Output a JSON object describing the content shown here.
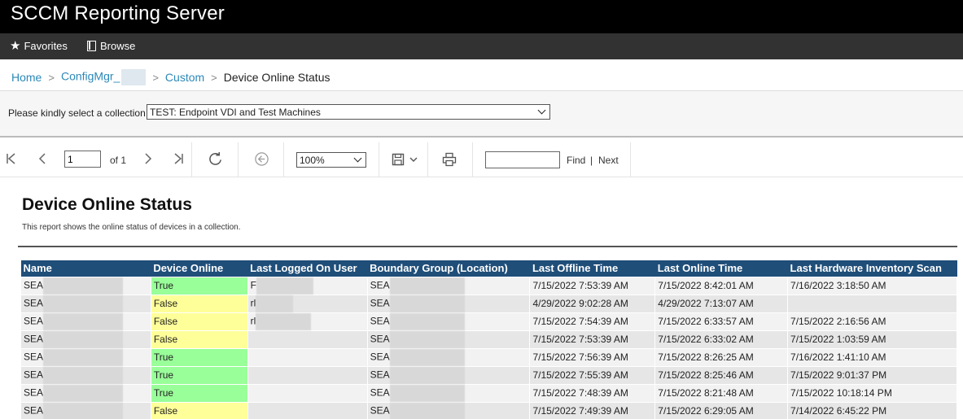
{
  "app": {
    "title": "SCCM Reporting Server"
  },
  "nav": {
    "favorites_label": "Favorites",
    "browse_label": "Browse"
  },
  "breadcrumb": {
    "home": "Home",
    "configmgr": "ConfigMgr_",
    "custom": "Custom",
    "current": "Device Online Status"
  },
  "parameters": {
    "collection_label": "Please kindly select a collection",
    "collection_value": "TEST: Endpoint VDI and Test Machines"
  },
  "toolbar": {
    "page_value": "1",
    "of_label": "of 1",
    "zoom_value": "100%",
    "find_label": "Find",
    "separator": "|",
    "next_label": "Next"
  },
  "report": {
    "title": "Device Online Status",
    "description": "This report shows the online status of devices in a collection."
  },
  "table": {
    "headers": [
      "Name",
      "Device Online",
      "Last Logged On User",
      "Boundary Group (Location)",
      "Last Offline Time",
      "Last Online Time",
      "Last Hardware Inventory Scan"
    ],
    "rows": [
      {
        "name": "SEA",
        "online": "True",
        "user": "F",
        "boundary": "SEA",
        "offline": "7/15/2022 7:53:39 AM",
        "online_time": "7/15/2022 8:42:01 AM",
        "hw_scan": "7/16/2022 3:18:50 AM"
      },
      {
        "name": "SEA",
        "online": "False",
        "user": "rl",
        "boundary": "SEA",
        "offline": "4/29/2022 9:02:28 AM",
        "online_time": "4/29/2022 7:13:07 AM",
        "hw_scan": ""
      },
      {
        "name": "SEA",
        "online": "False",
        "user": "rl",
        "boundary": "SEA",
        "offline": "7/15/2022 7:54:39 AM",
        "online_time": "7/15/2022 6:33:57 AM",
        "hw_scan": "7/15/2022 2:16:56 AM"
      },
      {
        "name": "SEA",
        "online": "False",
        "user": "",
        "boundary": "SEA",
        "offline": "7/15/2022 7:53:39 AM",
        "online_time": "7/15/2022 6:33:02 AM",
        "hw_scan": "7/15/2022 1:03:59 AM"
      },
      {
        "name": "SEA",
        "online": "True",
        "user": "",
        "boundary": "SEA",
        "offline": "7/15/2022 7:56:39 AM",
        "online_time": "7/15/2022 8:26:25 AM",
        "hw_scan": "7/16/2022 1:41:10 AM"
      },
      {
        "name": "SEA",
        "online": "True",
        "user": "",
        "boundary": "SEA",
        "offline": "7/15/2022 7:55:39 AM",
        "online_time": "7/15/2022 8:25:46 AM",
        "hw_scan": "7/15/2022 9:01:37 PM"
      },
      {
        "name": "SEA",
        "online": "True",
        "user": "",
        "boundary": "SEA",
        "offline": "7/15/2022 7:48:39 AM",
        "online_time": "7/15/2022 8:21:48 AM",
        "hw_scan": "7/15/2022 10:18:14 PM"
      },
      {
        "name": "SEA",
        "online": "False",
        "user": "",
        "boundary": "SEA",
        "offline": "7/15/2022 7:49:39 AM",
        "online_time": "7/15/2022 6:29:05 AM",
        "hw_scan": "7/14/2022 6:45:22 PM"
      }
    ]
  },
  "colors": {
    "header_bg": "#1f4e79",
    "online_true": "#99ff99",
    "online_false": "#ffff99",
    "link": "#2b88b8"
  }
}
